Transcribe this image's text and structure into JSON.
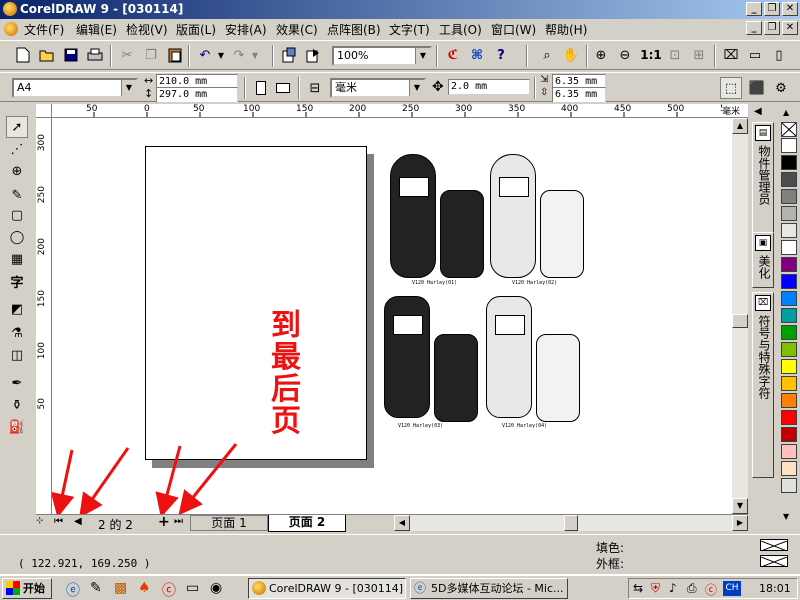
{
  "window": {
    "title": "CorelDRAW 9 - [030114]",
    "buttons": [
      "_",
      "❐",
      "✕"
    ],
    "doc_buttons": [
      "_",
      "❐",
      "✕"
    ]
  },
  "menu": [
    "文件(F)",
    "编辑(E)",
    "检视(V)",
    "版面(L)",
    "安排(A)",
    "效果(C)",
    "点阵图(B)",
    "文字(T)",
    "工具(O)",
    "窗口(W)",
    "帮助(H)"
  ],
  "toolbar": {
    "zoom": "100%"
  },
  "propbar": {
    "paper": "A4",
    "width": "210.0 mm",
    "height": "297.0 mm",
    "units": "毫米",
    "nudge": "2.0 mm",
    "dup_x": "6.35 mm",
    "dup_y": "6.35 mm"
  },
  "ruler": {
    "h_labels": [
      "50",
      "0",
      "50",
      "100",
      "150",
      "200",
      "250",
      "300",
      "350",
      "400",
      "450",
      "500",
      "550"
    ],
    "h_unit": "毫米",
    "v_labels": [
      "300",
      "250",
      "200",
      "150",
      "100",
      "50"
    ]
  },
  "canvas": {
    "annotation": [
      "到",
      "最",
      "后",
      "页"
    ],
    "phones": [
      {
        "label": "V120 Harley(01)",
        "color": "#222222"
      },
      {
        "label": "V120 Harley(02)",
        "color": "#e8e8e8"
      },
      {
        "label": "V120 Harley(03)",
        "color": "#222222"
      },
      {
        "label": "V120 Harley(04)",
        "color": "#e8e8e8"
      }
    ]
  },
  "pages": {
    "counter": "2 的 2",
    "tabs": [
      "页面 1",
      "页面 2"
    ]
  },
  "dockers": [
    "物件管理员",
    "美化",
    "符号与特殊字符"
  ],
  "palette": [
    "#ffffff",
    "#000000",
    "#4d4d4d",
    "#808080",
    "#b3b3b3",
    "#e6e6e6",
    "#ffffff",
    "#800080",
    "#0000ff",
    "#0080ff",
    "#00a0a0",
    "#00a000",
    "#80c000",
    "#ffff00",
    "#ffc000",
    "#ff8000",
    "#ff0000",
    "#c00000",
    "#ffc0c0",
    "#ffe0c0",
    "#e0e0e0"
  ],
  "status": {
    "coords": "( 122.921, 169.250 )",
    "fill_label": "填色:",
    "outline_label": "外框:"
  },
  "taskbar": {
    "start": "开始",
    "tasks": [
      "CorelDRAW 9 - [030114]",
      "5D多媒体互动论坛 - Mic..."
    ],
    "clock": "18:01",
    "ime": "CH"
  }
}
